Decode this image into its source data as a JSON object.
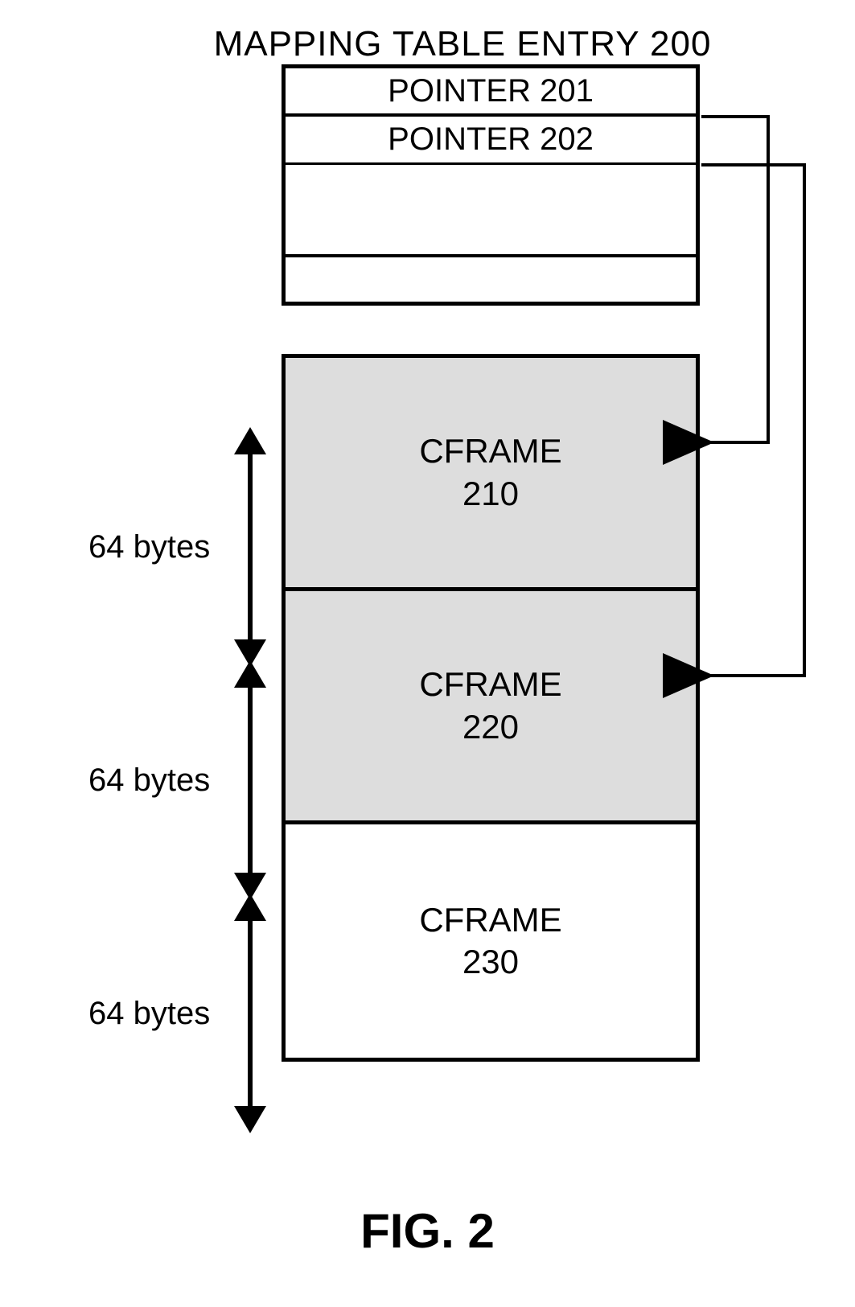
{
  "title": "MAPPING TABLE ENTRY 200",
  "table_rows": {
    "r0": "POINTER 201",
    "r1": "POINTER 202"
  },
  "frames": {
    "f0": {
      "name": "CFRAME",
      "id": "210",
      "size": "64 bytes"
    },
    "f1": {
      "name": "CFRAME",
      "id": "220",
      "size": "64 bytes"
    },
    "f2": {
      "name": "CFRAME",
      "id": "230",
      "size": "64 bytes"
    }
  },
  "figure_label": "FIG. 2"
}
